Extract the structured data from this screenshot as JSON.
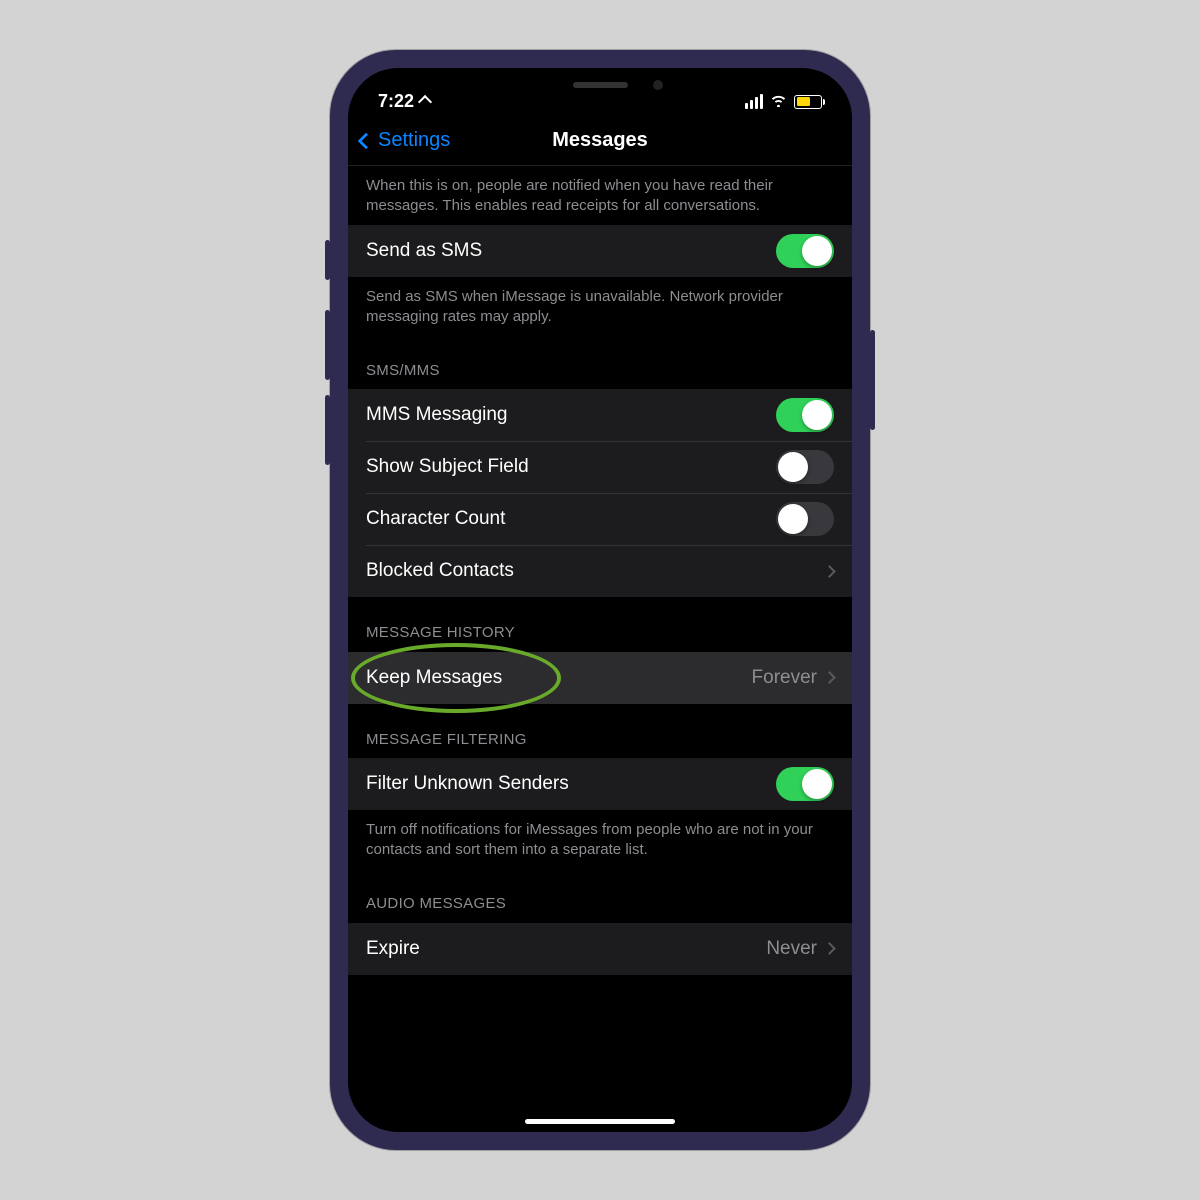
{
  "status": {
    "time": "7:22",
    "location_icon": "location-arrow"
  },
  "nav": {
    "back_label": "Settings",
    "title": "Messages"
  },
  "read_receipts": {
    "footer": "When this is on, people are notified when you have read their messages. This enables read receipts for all conversations."
  },
  "send_sms": {
    "label": "Send as SMS",
    "on": true,
    "footer": "Send as SMS when iMessage is unavailable. Network provider messaging rates may apply."
  },
  "sms_mms": {
    "header": "SMS/MMS",
    "mms": {
      "label": "MMS Messaging",
      "on": true
    },
    "subject": {
      "label": "Show Subject Field",
      "on": false
    },
    "char_count": {
      "label": "Character Count",
      "on": false
    },
    "blocked": {
      "label": "Blocked Contacts"
    }
  },
  "history": {
    "header": "MESSAGE HISTORY",
    "keep": {
      "label": "Keep Messages",
      "value": "Forever"
    }
  },
  "filtering": {
    "header": "MESSAGE FILTERING",
    "filter": {
      "label": "Filter Unknown Senders",
      "on": true
    },
    "footer": "Turn off notifications for iMessages from people who are not in your contacts and sort them into a separate list."
  },
  "audio": {
    "header": "AUDIO MESSAGES",
    "expire": {
      "label": "Expire",
      "value": "Never"
    }
  }
}
